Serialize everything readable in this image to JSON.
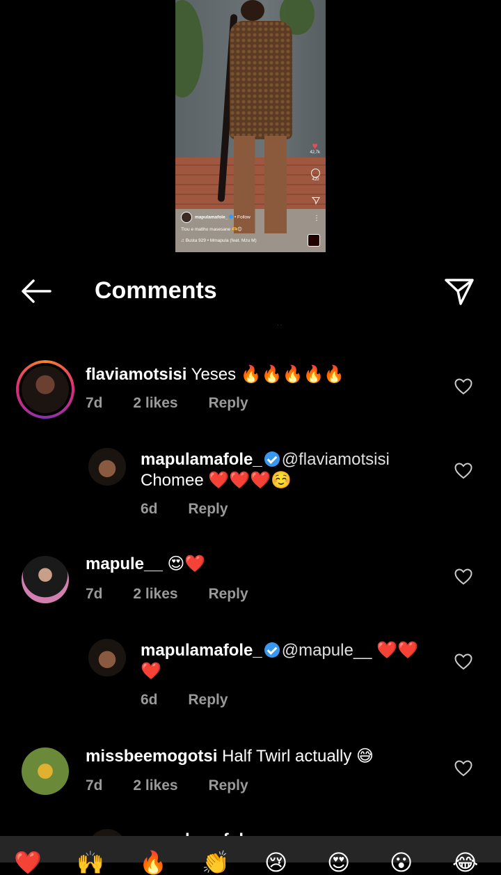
{
  "video": {
    "username": "mapulamafole_",
    "follow_label": "• Follow",
    "caption": "Tlou e matlho masesane 🫶😊",
    "music": "Busta 929 • Mmapula (feat. Mzu M)",
    "likes_count": "42,7k",
    "comments_count": "420"
  },
  "header": {
    "title": "Comments"
  },
  "comments": [
    {
      "username": "flaviamotsisi",
      "text": "Yeses 🔥🔥🔥🔥🔥",
      "age": "7d",
      "likes": "2 likes",
      "reply_label": "Reply",
      "avatar_ring": true
    },
    {
      "username": "mapulamafole_",
      "mention": "@flaviamotsisi",
      "text": "Chomee ❤️❤️❤️☺️",
      "age": "6d",
      "reply_label": "Reply",
      "verified": true
    },
    {
      "username": "mapule__",
      "text": "😍❤️",
      "age": "7d",
      "likes": "2 likes",
      "reply_label": "Reply"
    },
    {
      "username": "mapulamafole_",
      "mention": "@mapule__",
      "text": "❤️❤️",
      "text_line2": "❤️",
      "age": "6d",
      "reply_label": "Reply",
      "verified": true
    },
    {
      "username": "missbeemogotsi",
      "text": "Half Twirl actually 😅",
      "age": "7d",
      "likes": "2 likes",
      "reply_label": "Reply"
    }
  ],
  "partial_next_username": "mapulamafole_",
  "emoji_bar": [
    "❤️",
    "🙌",
    "🔥",
    "👏",
    "😢",
    "😍",
    "😮",
    "😂"
  ],
  "colors": {
    "background": "#000000",
    "meta_text": "#9a9a9a",
    "verified": "#3897f0",
    "emoji_bar": "#262626"
  }
}
